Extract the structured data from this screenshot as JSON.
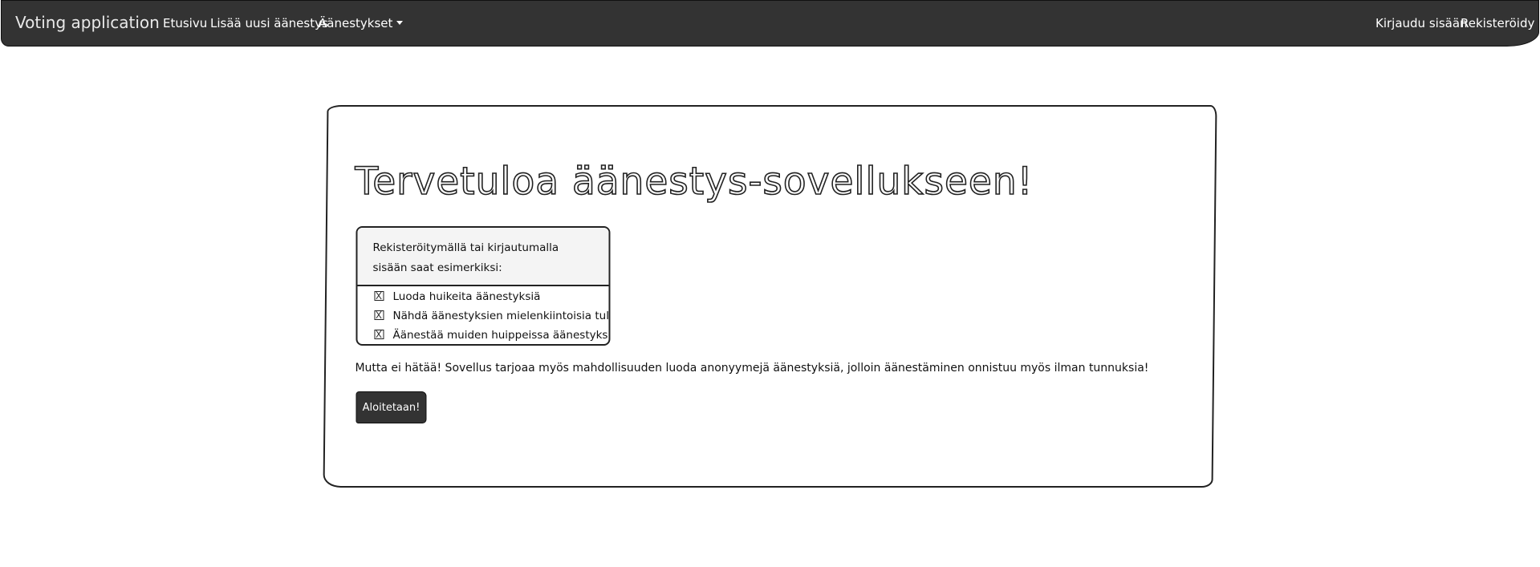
{
  "navbar": {
    "brand": "Voting application",
    "links": [
      {
        "label": "Etusivu"
      },
      {
        "label": "Lisää uusi äänestys"
      },
      {
        "label": "Äänestykset"
      }
    ],
    "right_links": [
      {
        "label": "Kirjaudu sisään"
      },
      {
        "label": "Rekisteröidy"
      }
    ],
    "dropdown_icon": "caret-down-icon"
  },
  "main": {
    "title": "Tervetuloa äänestys-sovellukseen!",
    "card": {
      "header": "Rekisteröitymällä tai kirjautumalla sisään saat esimerkiksi:",
      "items": [
        {
          "label": "Luoda huikeita äänestyksiä",
          "icon": "checkbox-x-icon"
        },
        {
          "label": "Nähdä äänestyksien mielenkiintoisia tuloksia",
          "icon": "checkbox-x-icon"
        },
        {
          "label": "Äänestää muiden huippeissa äänestyksissä",
          "icon": "checkbox-x-icon"
        }
      ]
    },
    "lead": "Mutta ei hätää! Sovellus tarjoaa myös mahdollisuuden luoda anonyymejä äänestyksiä, jolloin äänestäminen onnistuu myös ilman tunnuksia!",
    "button_label": "Aloitetaan!"
  },
  "colors": {
    "navbar_bg": "#333333",
    "navbar_text": "#ffffff",
    "button_bg": "#333333",
    "border": "#222222"
  }
}
